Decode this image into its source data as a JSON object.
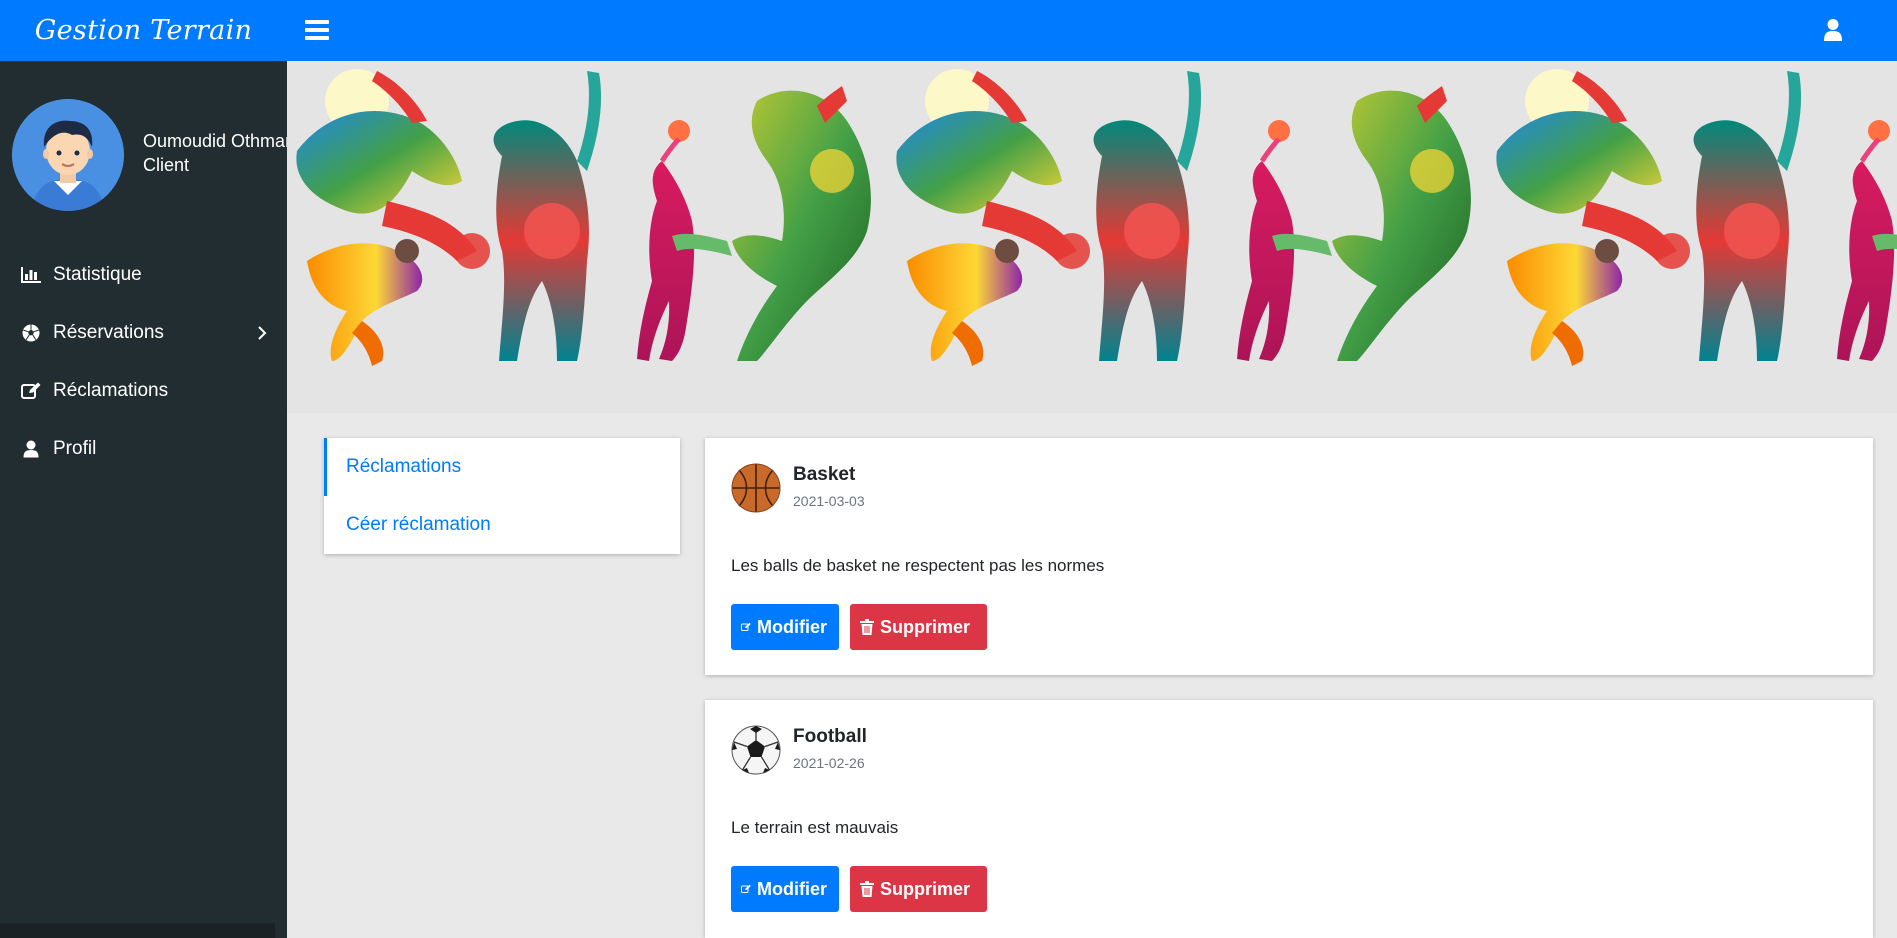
{
  "header": {
    "brand": "Gestion Terrain",
    "menu_icon": "hamburger-icon",
    "user_icon": "user-icon",
    "accent": "#007bff"
  },
  "sidebar": {
    "user_name": "Oumoudid Othman",
    "user_role": "Client",
    "background": "#222d32",
    "items": [
      {
        "label": "Statistique",
        "icon": "bar-chart-icon"
      },
      {
        "label": "Réservations",
        "icon": "soccer-ball-icon",
        "has_submenu": true
      },
      {
        "label": "Réclamations",
        "icon": "edit-icon"
      },
      {
        "label": "Profil",
        "icon": "user-icon"
      }
    ]
  },
  "subnav": {
    "items": [
      {
        "label": "Réclamations",
        "active": true
      },
      {
        "label": "Céer réclamation",
        "active": false
      }
    ]
  },
  "reclamations": [
    {
      "sport": "Basket",
      "date": "2021-03-03",
      "description": "Les balls de basket ne respectent pas les normes",
      "icon": "basketball-icon",
      "edit_label": "Modifier",
      "delete_label": "Supprimer"
    },
    {
      "sport": "Football",
      "date": "2021-02-26",
      "description": "Le terrain est mauvais",
      "icon": "soccer-ball-icon",
      "edit_label": "Modifier",
      "delete_label": "Supprimer"
    }
  ],
  "colors": {
    "primary": "#007bff",
    "danger": "#dc3545",
    "page_bg": "#e9e9e9"
  }
}
